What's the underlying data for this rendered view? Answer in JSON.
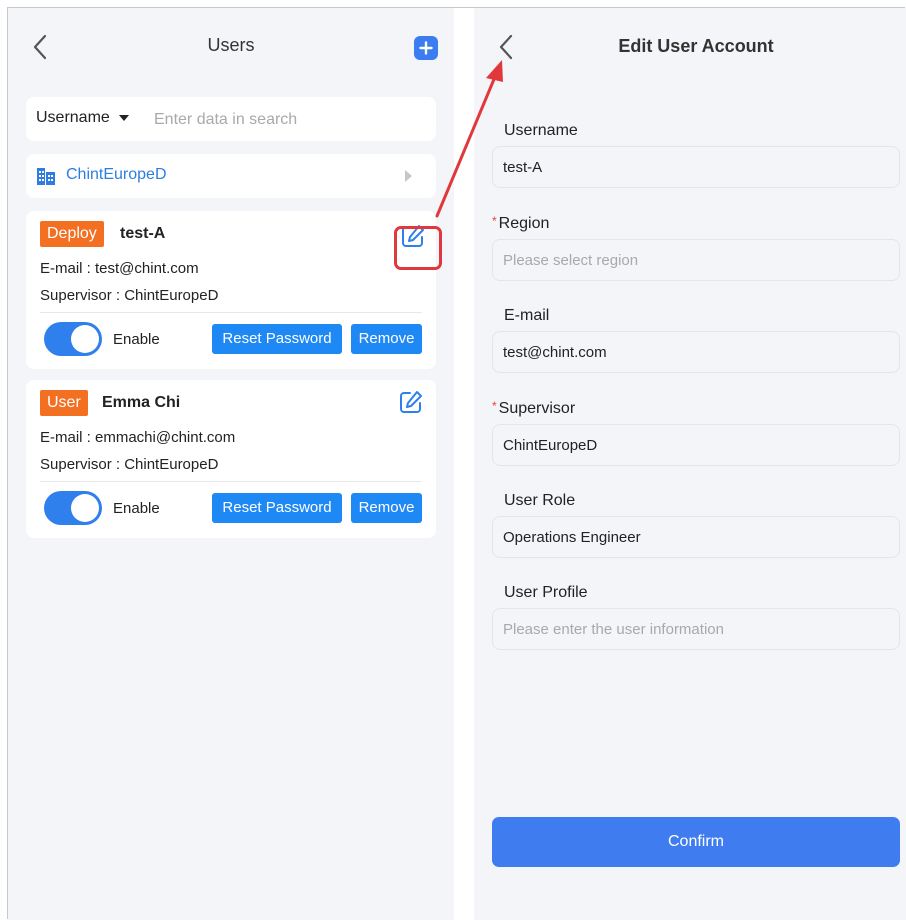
{
  "colors": {
    "accent": "#3b7cf0",
    "link_blue": "#2f7de1",
    "badge_orange": "#f36f21",
    "button_blue": "#1e88f5",
    "highlight_red": "#e0383b",
    "panel_bg": "#f4f5f8"
  },
  "users_screen": {
    "back_icon": "chevron-left-icon",
    "title": "Users",
    "add_icon": "plus-square-icon",
    "search": {
      "field_label": "Username",
      "placeholder": "Enter data in search"
    },
    "organization": {
      "icon": "building-icon",
      "label": "ChintEuropeD"
    },
    "users": [
      {
        "role": "Deploy",
        "name": "test-A",
        "email_line": "E-mail : test@chint.com",
        "supervisor_line": "Supervisor : ChintEuropeD",
        "enabled": true,
        "enable_label": "Enable",
        "reset_label": "Reset Password",
        "remove_label": "Remove",
        "highlighted_edit": true
      },
      {
        "role": "User",
        "name": "Emma Chi",
        "email_line": "E-mail : emmachi@chint.com",
        "supervisor_line": "Supervisor : ChintEuropeD",
        "enabled": true,
        "enable_label": "Enable",
        "reset_label": "Reset Password",
        "remove_label": "Remove",
        "highlighted_edit": false
      }
    ]
  },
  "edit_screen": {
    "back_icon": "chevron-left-icon",
    "title": "Edit User Account",
    "fields": {
      "username": {
        "label": "Username",
        "value": "test-A",
        "required": false
      },
      "region": {
        "label": "Region",
        "placeholder": "Please select region",
        "required": true
      },
      "email": {
        "label": "E-mail",
        "value": "test@chint.com",
        "required": false
      },
      "supervisor": {
        "label": "Supervisor",
        "value": "ChintEuropeD",
        "required": true
      },
      "user_role": {
        "label": "User Role",
        "value": "Operations Engineer",
        "required": false
      },
      "user_profile": {
        "label": "User Profile",
        "placeholder": "Please enter the user information",
        "required": false
      }
    },
    "required_mark": "*",
    "confirm_label": "Confirm"
  }
}
